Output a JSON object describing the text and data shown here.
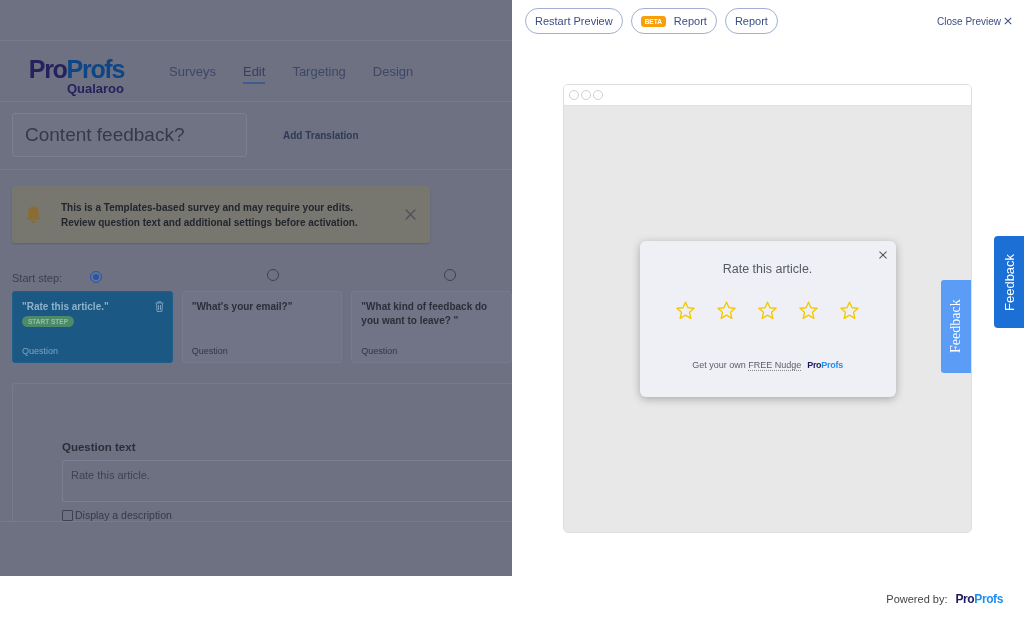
{
  "editor": {
    "brand": {
      "wordmark": [
        "Pro",
        "Profs"
      ],
      "product": "Qualaroo"
    },
    "nav": [
      {
        "label": "Surveys",
        "selected": false
      },
      {
        "label": "Edit",
        "selected": true
      },
      {
        "label": "Targeting",
        "selected": false
      },
      {
        "label": "Design",
        "selected": false
      }
    ],
    "survey_title": "Content feedback?",
    "add_translation": "Add Translation",
    "notice": {
      "lines": [
        "This is a Templates-based survey and may require your edits.",
        "Review question text and additional settings before activation."
      ]
    },
    "start_step_label": "Start step:",
    "steps": [
      {
        "title": "\"Rate this article.\"",
        "badge": "START STEP",
        "caption": "Question",
        "start": true,
        "selected": true
      },
      {
        "title": "\"What's your email?\"",
        "caption": "Question",
        "start": false,
        "selected": false
      },
      {
        "title": "\"What kind of feedback do you want to leave? \"",
        "caption": "Question",
        "start": false,
        "selected": false
      }
    ],
    "question": {
      "label": "Question text",
      "value": "Rate this article.",
      "description_option": {
        "label": "Display a description",
        "checked": false
      }
    }
  },
  "preview": {
    "toolbar": [
      {
        "label": "Restart Preview"
      },
      {
        "badge": "BETA",
        "label": "Report"
      },
      {
        "label": "Report"
      }
    ],
    "close": "Close Preview",
    "nudge": {
      "question": "Rate this article.",
      "stars": 0,
      "promo": {
        "text": "Get your own",
        "link": "FREE Nudge",
        "brand": [
          "Pro",
          "Profs"
        ]
      }
    },
    "page_tab": "Feedback",
    "side_tab": "Feedback"
  },
  "footer": {
    "label": "Powered by:",
    "brand": [
      "Pro",
      "Profs"
    ]
  }
}
